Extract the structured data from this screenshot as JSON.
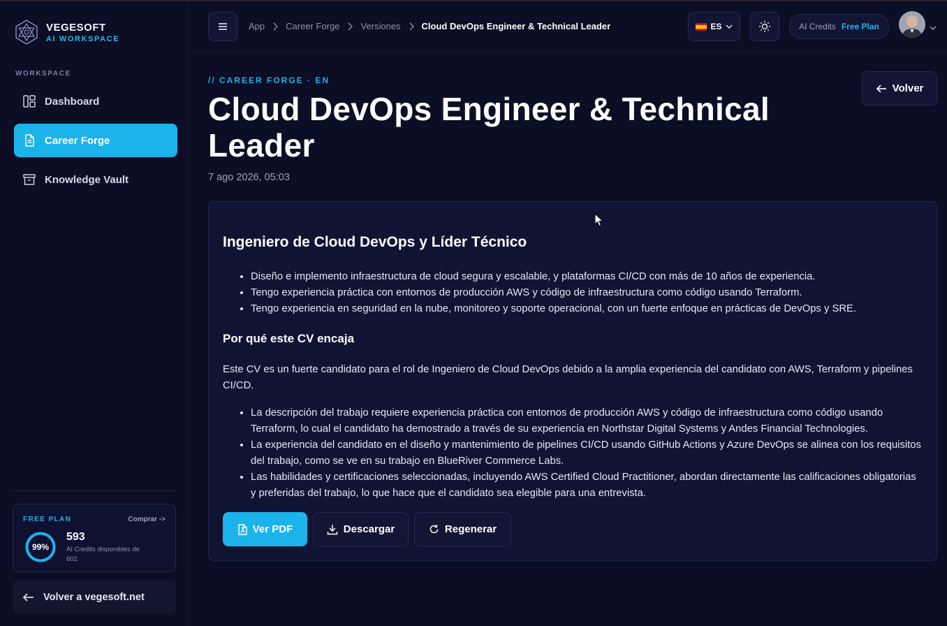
{
  "brand": {
    "name": "VEGESOFT",
    "subtitle": "AI WORKSPACE"
  },
  "sidebar": {
    "section_label": "WORKSPACE",
    "items": [
      {
        "label": "Dashboard",
        "icon": "dashboard-icon",
        "active": false
      },
      {
        "label": "Career Forge",
        "icon": "document-icon",
        "active": true
      },
      {
        "label": "Knowledge Vault",
        "icon": "archive-icon",
        "active": false
      }
    ],
    "plan": {
      "label": "FREE PLAN",
      "buy": "Comprar ->",
      "percent_text": "99%",
      "percent": 99,
      "credits": "593",
      "credits_desc": "AI Credits disponibles de 602"
    },
    "back_link": "Volver a vegesoft.net"
  },
  "topbar": {
    "breadcrumb": [
      "App",
      "Career Forge",
      "Versiones",
      "Cloud DevOps Engineer & Technical Leader"
    ],
    "language": "ES",
    "ai_credits_label": "AI Credits",
    "plan_label": "Free Plan"
  },
  "page": {
    "eyebrow": "// CAREER FORGE · EN",
    "title": "Cloud DevOps Engineer & Technical Leader",
    "date": "7 ago 2026, 05:03",
    "back_button": "Volver"
  },
  "content": {
    "heading": "Ingeniero de Cloud DevOps y Líder Técnico",
    "summary": [
      "Diseño e implemento infraestructura de cloud segura y escalable, y plataformas CI/CD con más de 10 años de experiencia.",
      "Tengo experiencia práctica con entornos de producción AWS y código de infraestructura como código usando Terraform.",
      "Tengo experiencia en seguridad en la nube, monitoreo y soporte operacional, con un fuerte enfoque en prácticas de DevOps y SRE."
    ],
    "fit_heading": "Por qué este CV encaja",
    "fit_paragraph": "Este CV es un fuerte candidato para el rol de Ingeniero de Cloud DevOps debido a la amplia experiencia del candidato con AWS, Terraform y pipelines CI/CD.",
    "fit_points": [
      "La descripción del trabajo requiere experiencia práctica con entornos de producción AWS y código de infraestructura como código usando Terraform, lo cual el candidato ha demostrado a través de su experiencia en Northstar Digital Systems y Andes Financial Technologies.",
      "La experiencia del candidato en el diseño y mantenimiento de pipelines CI/CD usando GitHub Actions y Azure DevOps se alinea con los requisitos del trabajo, como se ve en su trabajo en BlueRiver Commerce Labs.",
      "Las habilidades y certificaciones seleccionadas, incluyendo AWS Certified Cloud Practitioner, abordan directamente las calificaciones obligatorias y preferidas del trabajo, lo que hace que el candidato sea elegible para una entrevista."
    ],
    "actions": {
      "pdf": "Ver PDF",
      "download": "Descargar",
      "regenerate": "Regenerar"
    }
  },
  "colors": {
    "accent": "#1bb3ea",
    "background": "#0b0e24",
    "card": "#0f1433"
  }
}
